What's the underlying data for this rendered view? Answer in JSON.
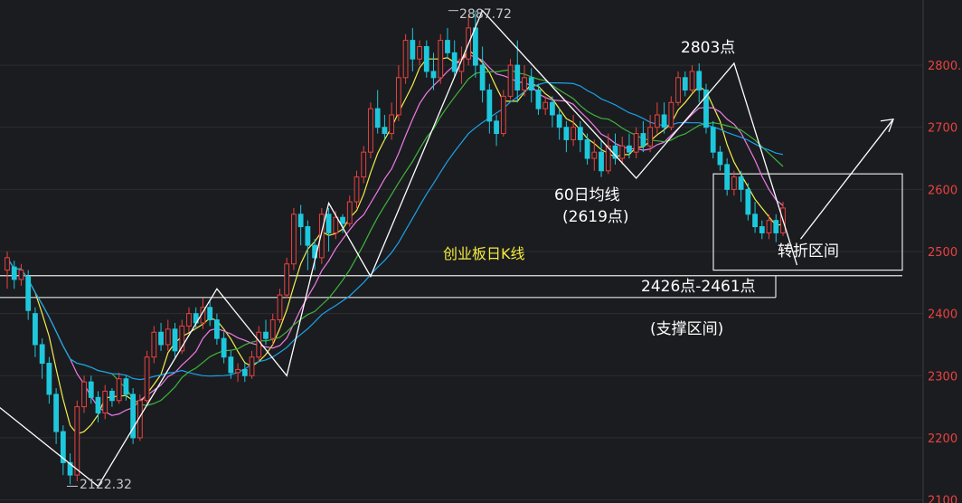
{
  "chart_data": {
    "type": "candlestick",
    "title": "创业板日K线",
    "yaxis": {
      "ticks": [
        2100,
        2200,
        2300,
        2400,
        2500,
        2600,
        2700,
        2800
      ],
      "tick_labels": [
        "2100",
        "2200",
        "2300",
        "2400",
        "2500",
        "2600",
        "2700",
        "2800."
      ],
      "ylim": [
        2095,
        2905
      ],
      "side": "right",
      "color": "#e8433f"
    },
    "grid": true,
    "annotations": {
      "high": "2887.72",
      "low": "2122.32",
      "peak2": "2803点",
      "ma60_label": "60日均线",
      "ma60_value": "(2619点)",
      "support_range": "2426点-2461点",
      "support_label": "(支撑区间)",
      "turn_label": "转折区间"
    },
    "ranges": {
      "support_zone": [
        2426,
        2461
      ],
      "turn_zone": [
        2470,
        2625
      ]
    },
    "colors": {
      "up": "#e8433f",
      "down": "#1ec8dc",
      "ma5": "#ffffff",
      "ma10": "#f3ef4c",
      "ma20": "#f07ce6",
      "ma30": "#3fb43b",
      "ma60": "#1aa3e8",
      "label_yellow": "#f5ea3c"
    },
    "candles": [
      [
        2470,
        2490,
        2440,
        2500
      ],
      [
        2475,
        2455,
        2440,
        2485
      ],
      [
        2455,
        2470,
        2445,
        2480
      ],
      [
        2460,
        2405,
        2390,
        2470
      ],
      [
        2400,
        2350,
        2330,
        2410
      ],
      [
        2350,
        2320,
        2295,
        2360
      ],
      [
        2320,
        2270,
        2255,
        2330
      ],
      [
        2270,
        2210,
        2190,
        2280
      ],
      [
        2210,
        2160,
        2140,
        2220
      ],
      [
        2160,
        2140,
        2125,
        2175
      ],
      [
        2140,
        2250,
        2130,
        2260
      ],
      [
        2250,
        2290,
        2240,
        2300
      ],
      [
        2290,
        2265,
        2255,
        2300
      ],
      [
        2265,
        2240,
        2225,
        2275
      ],
      [
        2240,
        2275,
        2230,
        2285
      ],
      [
        2275,
        2260,
        2250,
        2280
      ],
      [
        2260,
        2295,
        2255,
        2305
      ],
      [
        2295,
        2270,
        2260,
        2300
      ],
      [
        2270,
        2200,
        2190,
        2280
      ],
      [
        2200,
        2260,
        2195,
        2270
      ],
      [
        2260,
        2330,
        2255,
        2340
      ],
      [
        2330,
        2370,
        2320,
        2380
      ],
      [
        2370,
        2350,
        2340,
        2385
      ],
      [
        2350,
        2375,
        2340,
        2390
      ],
      [
        2375,
        2340,
        2330,
        2385
      ],
      [
        2340,
        2380,
        2335,
        2390
      ],
      [
        2380,
        2400,
        2370,
        2410
      ],
      [
        2400,
        2385,
        2375,
        2410
      ],
      [
        2385,
        2410,
        2375,
        2425
      ],
      [
        2410,
        2390,
        2380,
        2420
      ],
      [
        2390,
        2360,
        2350,
        2400
      ],
      [
        2360,
        2330,
        2320,
        2370
      ],
      [
        2330,
        2305,
        2295,
        2340
      ],
      [
        2305,
        2310,
        2290,
        2320
      ],
      [
        2310,
        2300,
        2290,
        2320
      ],
      [
        2300,
        2330,
        2295,
        2340
      ],
      [
        2330,
        2370,
        2325,
        2380
      ],
      [
        2370,
        2360,
        2350,
        2390
      ],
      [
        2360,
        2390,
        2350,
        2400
      ],
      [
        2390,
        2430,
        2385,
        2440
      ],
      [
        2430,
        2480,
        2425,
        2490
      ],
      [
        2480,
        2560,
        2470,
        2570
      ],
      [
        2560,
        2540,
        2510,
        2575
      ],
      [
        2540,
        2510,
        2470,
        2550
      ],
      [
        2510,
        2490,
        2470,
        2520
      ],
      [
        2490,
        2560,
        2480,
        2570
      ],
      [
        2560,
        2530,
        2500,
        2570
      ],
      [
        2530,
        2555,
        2520,
        2565
      ],
      [
        2555,
        2545,
        2530,
        2560
      ],
      [
        2545,
        2580,
        2540,
        2590
      ],
      [
        2580,
        2620,
        2570,
        2630
      ],
      [
        2620,
        2660,
        2610,
        2670
      ],
      [
        2660,
        2730,
        2650,
        2740
      ],
      [
        2730,
        2700,
        2690,
        2760
      ],
      [
        2700,
        2690,
        2680,
        2720
      ],
      [
        2690,
        2720,
        2680,
        2740
      ],
      [
        2720,
        2780,
        2710,
        2800
      ],
      [
        2780,
        2840,
        2770,
        2850
      ],
      [
        2840,
        2810,
        2790,
        2860
      ],
      [
        2810,
        2830,
        2800,
        2840
      ],
      [
        2830,
        2790,
        2780,
        2840
      ],
      [
        2790,
        2780,
        2760,
        2820
      ],
      [
        2780,
        2840,
        2770,
        2850
      ],
      [
        2840,
        2820,
        2810,
        2860
      ],
      [
        2820,
        2790,
        2780,
        2840
      ],
      [
        2790,
        2810,
        2770,
        2830
      ],
      [
        2810,
        2860,
        2800,
        2880
      ],
      [
        2860,
        2800,
        2780,
        2888
      ],
      [
        2800,
        2760,
        2740,
        2830
      ],
      [
        2760,
        2710,
        2690,
        2770
      ],
      [
        2710,
        2690,
        2670,
        2720
      ],
      [
        2690,
        2750,
        2685,
        2760
      ],
      [
        2750,
        2800,
        2745,
        2810
      ],
      [
        2800,
        2760,
        2740,
        2840
      ],
      [
        2760,
        2780,
        2750,
        2800
      ],
      [
        2780,
        2760,
        2740,
        2795
      ],
      [
        2760,
        2730,
        2720,
        2770
      ],
      [
        2730,
        2740,
        2720,
        2750
      ],
      [
        2740,
        2720,
        2700,
        2750
      ],
      [
        2720,
        2700,
        2680,
        2730
      ],
      [
        2700,
        2680,
        2660,
        2710
      ],
      [
        2680,
        2700,
        2670,
        2720
      ],
      [
        2700,
        2680,
        2660,
        2710
      ],
      [
        2680,
        2650,
        2640,
        2690
      ],
      [
        2650,
        2660,
        2630,
        2680
      ],
      [
        2660,
        2630,
        2620,
        2680
      ],
      [
        2630,
        2670,
        2625,
        2690
      ],
      [
        2670,
        2650,
        2640,
        2690
      ],
      [
        2650,
        2670,
        2640,
        2685
      ],
      [
        2670,
        2660,
        2650,
        2690
      ],
      [
        2660,
        2690,
        2650,
        2700
      ],
      [
        2690,
        2670,
        2660,
        2710
      ],
      [
        2670,
        2700,
        2660,
        2720
      ],
      [
        2700,
        2720,
        2690,
        2740
      ],
      [
        2720,
        2700,
        2690,
        2740
      ],
      [
        2700,
        2740,
        2695,
        2750
      ],
      [
        2740,
        2780,
        2735,
        2790
      ],
      [
        2780,
        2760,
        2750,
        2790
      ],
      [
        2760,
        2790,
        2755,
        2800
      ],
      [
        2790,
        2760,
        2740,
        2803
      ],
      [
        2760,
        2700,
        2690,
        2770
      ],
      [
        2700,
        2660,
        2650,
        2710
      ],
      [
        2660,
        2640,
        2630,
        2670
      ],
      [
        2640,
        2600,
        2590,
        2650
      ],
      [
        2600,
        2620,
        2590,
        2630
      ],
      [
        2620,
        2600,
        2580,
        2630
      ],
      [
        2600,
        2560,
        2550,
        2610
      ],
      [
        2560,
        2540,
        2530,
        2580
      ],
      [
        2540,
        2530,
        2520,
        2550
      ],
      [
        2530,
        2550,
        2520,
        2560
      ],
      [
        2550,
        2530,
        2515,
        2560
      ],
      [
        2530,
        2570,
        2525,
        2580
      ]
    ]
  }
}
